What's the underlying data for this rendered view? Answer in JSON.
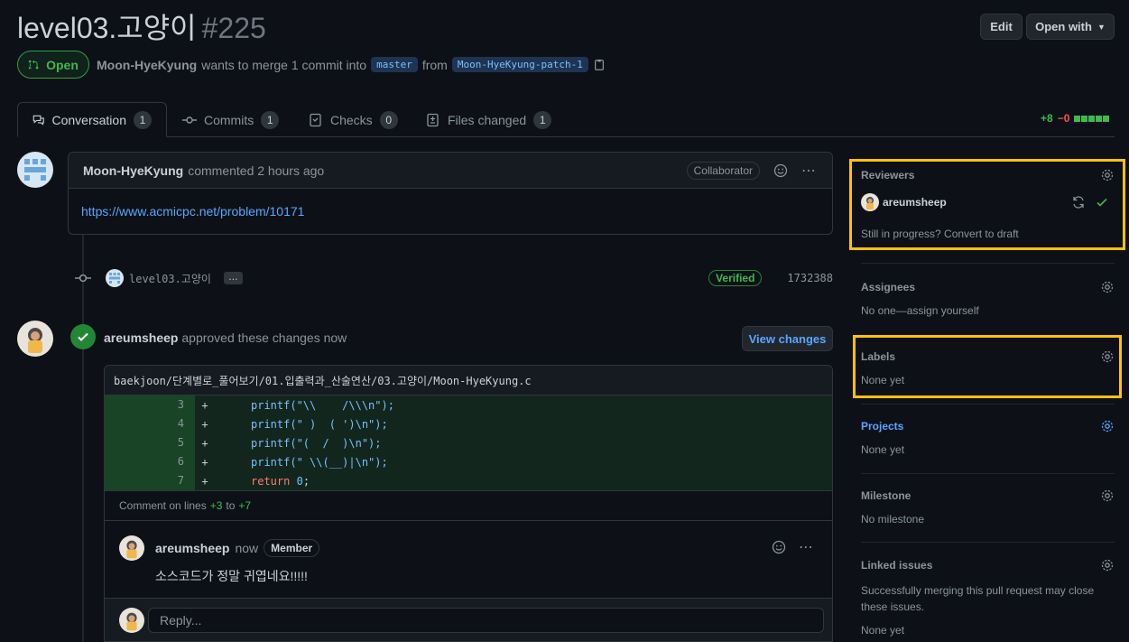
{
  "pr": {
    "title": "level03.고양이",
    "number": "#225",
    "state": "Open",
    "author": "Moon-HyeKyung",
    "merge_text": "wants to merge 1 commit into",
    "base_branch": "master",
    "from_text": "from",
    "head_branch": "Moon-HyeKyung-patch-1"
  },
  "header_buttons": {
    "edit": "Edit",
    "open_with": "Open with"
  },
  "tabs": [
    {
      "label": "Conversation",
      "count": "1"
    },
    {
      "label": "Commits",
      "count": "1"
    },
    {
      "label": "Checks",
      "count": "0"
    },
    {
      "label": "Files changed",
      "count": "1"
    }
  ],
  "diffstat": {
    "additions": "+8",
    "deletions": "−0"
  },
  "comment1": {
    "author": "Moon-HyeKyung",
    "meta": "commented 2 hours ago",
    "role": "Collaborator",
    "body_link": "https://www.acmicpc.net/problem/10171"
  },
  "commit": {
    "message": "level03.고양이",
    "more": "…",
    "verified": "Verified",
    "sha": "1732388"
  },
  "review": {
    "author": "areumsheep",
    "action": "approved these changes",
    "time": "now",
    "view_changes": "View changes",
    "file_path": "baekjoon/단계별로_풀어보기/01.입출력과_산술연산/03.고양이/Moon-HyeKyung.c",
    "lines": [
      {
        "num": "3",
        "sign": "+",
        "code": "printf(\"\\\\    /\\\\\\n\");"
      },
      {
        "num": "4",
        "sign": "+",
        "code": "printf(\" )  ( ')\\n\");"
      },
      {
        "num": "5",
        "sign": "+",
        "code": "printf(\"(  /  )\\n\");"
      },
      {
        "num": "6",
        "sign": "+",
        "code": "printf(\" \\\\(__)|\\n\");"
      },
      {
        "num": "7",
        "sign": "+",
        "code_kw": "return",
        "code_num": "0",
        "code_end": ";"
      }
    ],
    "range_prefix": "Comment on lines",
    "range_start": "+3",
    "range_to": "to",
    "range_end": "+7",
    "inner_author": "areumsheep",
    "inner_time": "now",
    "inner_role": "Member",
    "inner_body": "소스코드가 정말 귀엽네요!!!!!",
    "reply_placeholder": "Reply..."
  },
  "sidebar": {
    "reviewers_title": "Reviewers",
    "reviewer_name": "areumsheep",
    "draft_text": "Still in progress? Convert to draft",
    "assignees_title": "Assignees",
    "assignees_text": "No one—assign yourself",
    "labels_title": "Labels",
    "labels_text": "None yet",
    "projects_title": "Projects",
    "projects_text": "None yet",
    "milestone_title": "Milestone",
    "milestone_text": "No milestone",
    "linked_title": "Linked issues",
    "linked_text": "Successfully merging this pull request may close these issues.",
    "linked_none": "None yet"
  },
  "colors": {
    "highlight": "#ffc107",
    "green": "#3fb950",
    "link": "#58a6ff",
    "bg": "#0d1117"
  }
}
